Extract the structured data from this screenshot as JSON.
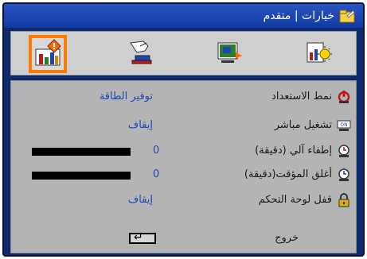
{
  "window": {
    "title": "خيارات | متقدم",
    "title_icon": "folder-icon"
  },
  "tabs": [
    {
      "name": "tab-advanced-options",
      "icon": "settings-chart-icon",
      "active": true
    },
    {
      "name": "tab-remote",
      "icon": "hand-remote-icon",
      "active": false
    },
    {
      "name": "tab-display",
      "icon": "screen-arrow-icon",
      "active": false
    },
    {
      "name": "tab-lamp",
      "icon": "lamp-chart-icon",
      "active": false
    }
  ],
  "rows": [
    {
      "label": "نمط الاستعداد",
      "value": "توفير الطاقة",
      "icon": "power-icon"
    },
    {
      "label": "تشغيل مباشر",
      "value": "إيقاف",
      "icon": "on-button-icon"
    },
    {
      "label": "إطفاء آلي (دقيقة)",
      "number": "0",
      "bar_fraction": 1.0,
      "icon": "clock-icon"
    },
    {
      "label": "أغلق المؤقت(دقيقة)",
      "number": "0",
      "bar_fraction": 1.0,
      "icon": "timer-icon"
    },
    {
      "label": "قفل لوحة التحكم",
      "value": "إيقاف",
      "icon": "lock-icon"
    }
  ],
  "footer": {
    "exit_label": "خروج",
    "enter_symbol": "↵"
  },
  "colors": {
    "title_bar": "#1a47b4",
    "panel": "#b4b4b4",
    "value_text": "#1f48b8",
    "active_tab_outline": "#ff7a00"
  }
}
